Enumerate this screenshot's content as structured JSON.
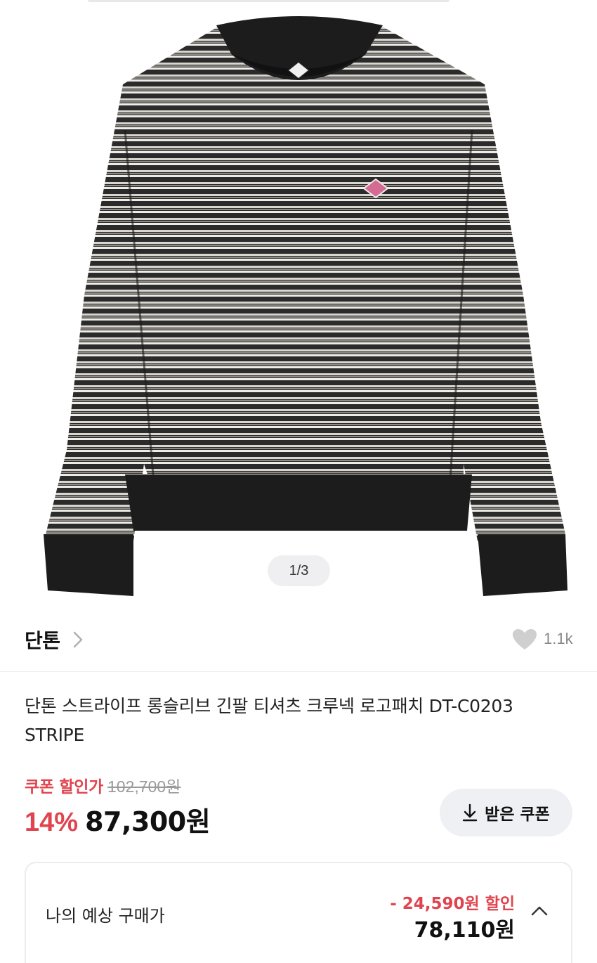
{
  "gallery": {
    "counter": "1/3"
  },
  "brand": {
    "name": "단톤",
    "like_count": "1.1k"
  },
  "product": {
    "title": "단톤 스트라이프 롱슬리브 긴팔 티셔츠 크루넥 로고패치 DT-C0203 STRIPE",
    "coupon_label": "쿠폰 할인가",
    "original_price": "102,700원",
    "discount_rate": "14%",
    "sale_price": "87,300원",
    "coupon_button": "받은 쿠폰"
  },
  "estimate": {
    "label": "나의 예상 구매가",
    "discount": "- 24,590원 할인",
    "price": "78,110원"
  },
  "colors": {
    "accent_red": "#e0454f",
    "like_gray": "#cfcfcf"
  },
  "icons": [
    "chevron-right-icon",
    "heart-icon",
    "download-icon",
    "chevron-up-icon"
  ]
}
